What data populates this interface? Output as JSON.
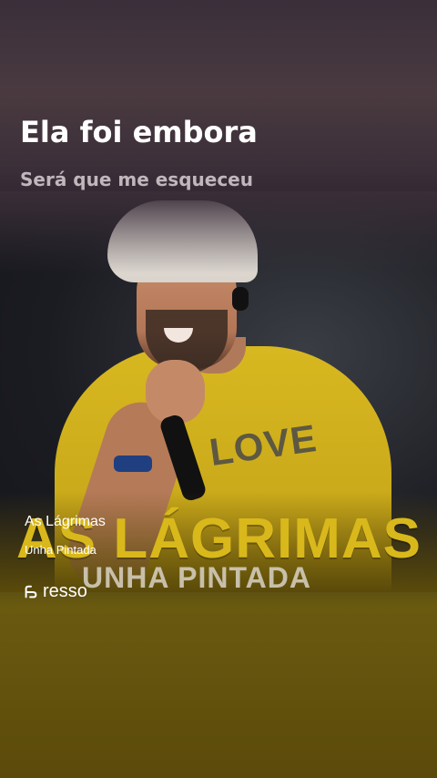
{
  "lyrics": {
    "current_line": "Ela foi embora",
    "next_line": "Será que me esqueceu"
  },
  "artwork": {
    "title_text": "AS LÁGRIMAS",
    "subtitle_text": "UNHA PINTADA",
    "shirt_text": "LOVE"
  },
  "track": {
    "title": "As Lágrimas",
    "artist": "Unha Pintada"
  },
  "brand": {
    "name": "resso",
    "icon": "resso-logo-icon"
  },
  "colors": {
    "accent_yellow": "#d9b81c",
    "text_white": "#ffffff"
  }
}
